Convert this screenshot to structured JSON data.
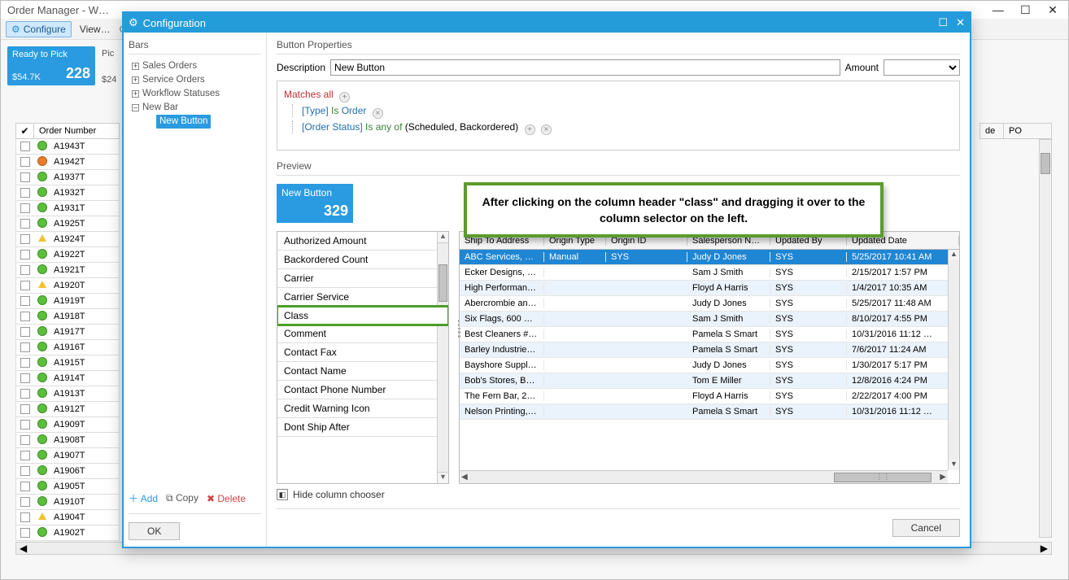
{
  "main": {
    "title": "Order Manager - W…",
    "toolbar": {
      "configure": "Configure",
      "view": "View…"
    }
  },
  "cards": {
    "ready": {
      "label": "Ready to Pick",
      "sub": "$54.7K",
      "value": "228"
    },
    "partial": {
      "label": "Pic",
      "sub": "$24"
    }
  },
  "orders": {
    "header_number": "Order Number",
    "right_headers": {
      "de": "de",
      "po": "PO"
    },
    "rows": [
      {
        "num": "A1943T",
        "dot": "g"
      },
      {
        "num": "A1942T",
        "dot": "o"
      },
      {
        "num": "A1937T",
        "dot": "g"
      },
      {
        "num": "A1932T",
        "dot": "g"
      },
      {
        "num": "A1931T",
        "dot": "g"
      },
      {
        "num": "A1925T",
        "dot": "g"
      },
      {
        "num": "A1924T",
        "dot": "t"
      },
      {
        "num": "A1922T",
        "dot": "g"
      },
      {
        "num": "A1921T",
        "dot": "g"
      },
      {
        "num": "A1920T",
        "dot": "t"
      },
      {
        "num": "A1919T",
        "dot": "g"
      },
      {
        "num": "A1918T",
        "dot": "g"
      },
      {
        "num": "A1917T",
        "dot": "g"
      },
      {
        "num": "A1916T",
        "dot": "g"
      },
      {
        "num": "A1915T",
        "dot": "g"
      },
      {
        "num": "A1914T",
        "dot": "g"
      },
      {
        "num": "A1913T",
        "dot": "g"
      },
      {
        "num": "A1912T",
        "dot": "g"
      },
      {
        "num": "A1909T",
        "dot": "g"
      },
      {
        "num": "A1908T",
        "dot": "g"
      },
      {
        "num": "A1907T",
        "dot": "g"
      },
      {
        "num": "A1906T",
        "dot": "g"
      },
      {
        "num": "A1905T",
        "dot": "g"
      },
      {
        "num": "A1910T",
        "dot": "g"
      },
      {
        "num": "A1904T",
        "dot": "t"
      },
      {
        "num": "A1902T",
        "dot": "g"
      }
    ]
  },
  "modal": {
    "title": "Configuration",
    "bars_label": "Bars",
    "tree": {
      "n1": "Sales Orders",
      "n2": "Service Orders",
      "n3": "Workflow Statuses",
      "n4": "New Bar",
      "n5": "New Button"
    },
    "actions": {
      "add": "Add",
      "copy": "Copy",
      "delete": "Delete"
    },
    "ok": "OK",
    "bp_label": "Button Properties",
    "desc_label": "Description",
    "desc_value": "New Button",
    "amount_label": "Amount",
    "rules": {
      "matches": "Matches all",
      "type": "[Type]",
      "is": "Is",
      "order": "Order",
      "ostatus": "[Order Status]",
      "anyof": "Is any of",
      "vals": "(Scheduled, Backordered)"
    },
    "preview_label": "Preview",
    "preview": {
      "title": "New Button",
      "value": "329"
    },
    "column_chooser": [
      "Authorized Amount",
      "Backordered Count",
      "Carrier",
      "Carrier Service",
      "Class",
      "Comment",
      "Contact Fax",
      "Contact Name",
      "Contact Phone Number",
      "Credit Warning Icon",
      "Dont Ship After"
    ],
    "hide_chooser": "Hide column chooser",
    "cancel": "Cancel",
    "table": {
      "cols": {
        "ship": "Ship To Address",
        "otype": "Origin Type",
        "oid": "Origin ID",
        "sales": "Salesperson Name",
        "upd": "Updated By",
        "date": "Updated Date"
      },
      "rows": [
        {
          "ship": "ABC Services, F…",
          "otype": "Manual",
          "oid": "SYS",
          "sales": "Judy D Jones",
          "upd": "SYS",
          "date": "5/25/2017 10:41 AM",
          "sel": true
        },
        {
          "ship": "Ecker Designs, …",
          "otype": "",
          "oid": "",
          "sales": "Sam J Smith",
          "upd": "SYS",
          "date": "2/15/2017 1:57 PM"
        },
        {
          "ship": "High Performan…",
          "otype": "",
          "oid": "",
          "sales": "Floyd A Harris",
          "upd": "SYS",
          "date": "1/4/2017 10:35 AM",
          "alt": true
        },
        {
          "ship": "Abercrombie an…",
          "otype": "",
          "oid": "",
          "sales": "Judy D Jones",
          "upd": "SYS",
          "date": "5/25/2017 11:48 AM"
        },
        {
          "ship": "Six Flags, 600 S…",
          "otype": "",
          "oid": "",
          "sales": "Sam J Smith",
          "upd": "SYS",
          "date": "8/10/2017 4:55 PM",
          "alt": true
        },
        {
          "ship": "Best Cleaners #…",
          "otype": "",
          "oid": "",
          "sales": "Pamela S Smart",
          "upd": "SYS",
          "date": "10/31/2016 11:12 …"
        },
        {
          "ship": "Barley Industrie…",
          "otype": "",
          "oid": "",
          "sales": "Pamela S Smart",
          "upd": "SYS",
          "date": "7/6/2017 11:24 AM",
          "alt": true
        },
        {
          "ship": "Bayshore Suppl…",
          "otype": "",
          "oid": "",
          "sales": "Judy D Jones",
          "upd": "SYS",
          "date": "1/30/2017 5:17 PM"
        },
        {
          "ship": "Bob's Stores, B…",
          "otype": "",
          "oid": "",
          "sales": "Tom E Miller",
          "upd": "SYS",
          "date": "12/8/2016 4:24 PM",
          "alt": true
        },
        {
          "ship": "The Fern Bar, 2…",
          "otype": "",
          "oid": "",
          "sales": "Floyd A Harris",
          "upd": "SYS",
          "date": "2/22/2017 4:00 PM"
        },
        {
          "ship": "Nelson Printing,…",
          "otype": "",
          "oid": "",
          "sales": "Pamela S Smart",
          "upd": "SYS",
          "date": "10/31/2016 11:12 …",
          "alt": true
        }
      ]
    }
  },
  "callout": "After clicking on the column header \"class\" and dragging it over to the column selector on the left."
}
